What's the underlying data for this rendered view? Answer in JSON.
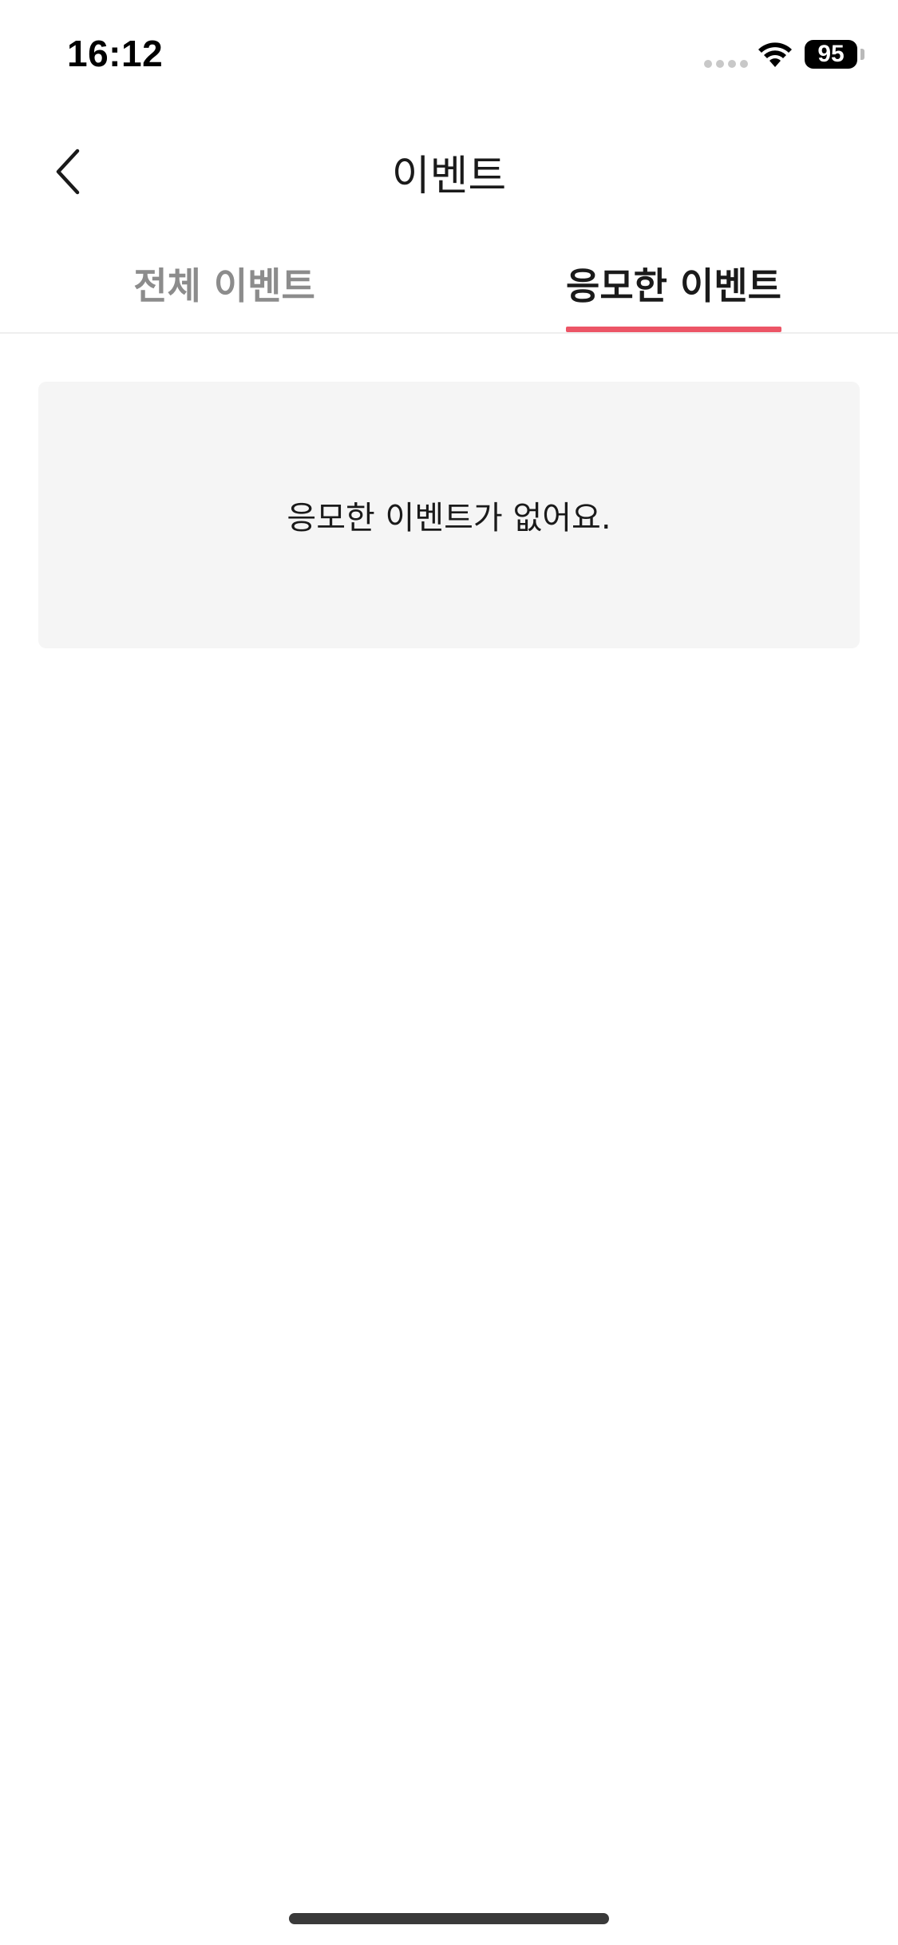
{
  "status_bar": {
    "time": "16:12",
    "battery": "95"
  },
  "nav": {
    "title": "이벤트"
  },
  "tabs": [
    {
      "label": "전체 이벤트",
      "active": false
    },
    {
      "label": "응모한 이벤트",
      "active": true
    }
  ],
  "empty_state": {
    "message": "응모한 이벤트가 없어요."
  },
  "colors": {
    "accent": "#ec5566",
    "inactive_tab": "#8c8c8c",
    "card_bg": "#f5f5f5"
  },
  "icons": {
    "back": "chevron-left-icon",
    "wifi": "wifi-icon",
    "signal": "cellular-signal-icon",
    "battery": "battery-icon"
  }
}
